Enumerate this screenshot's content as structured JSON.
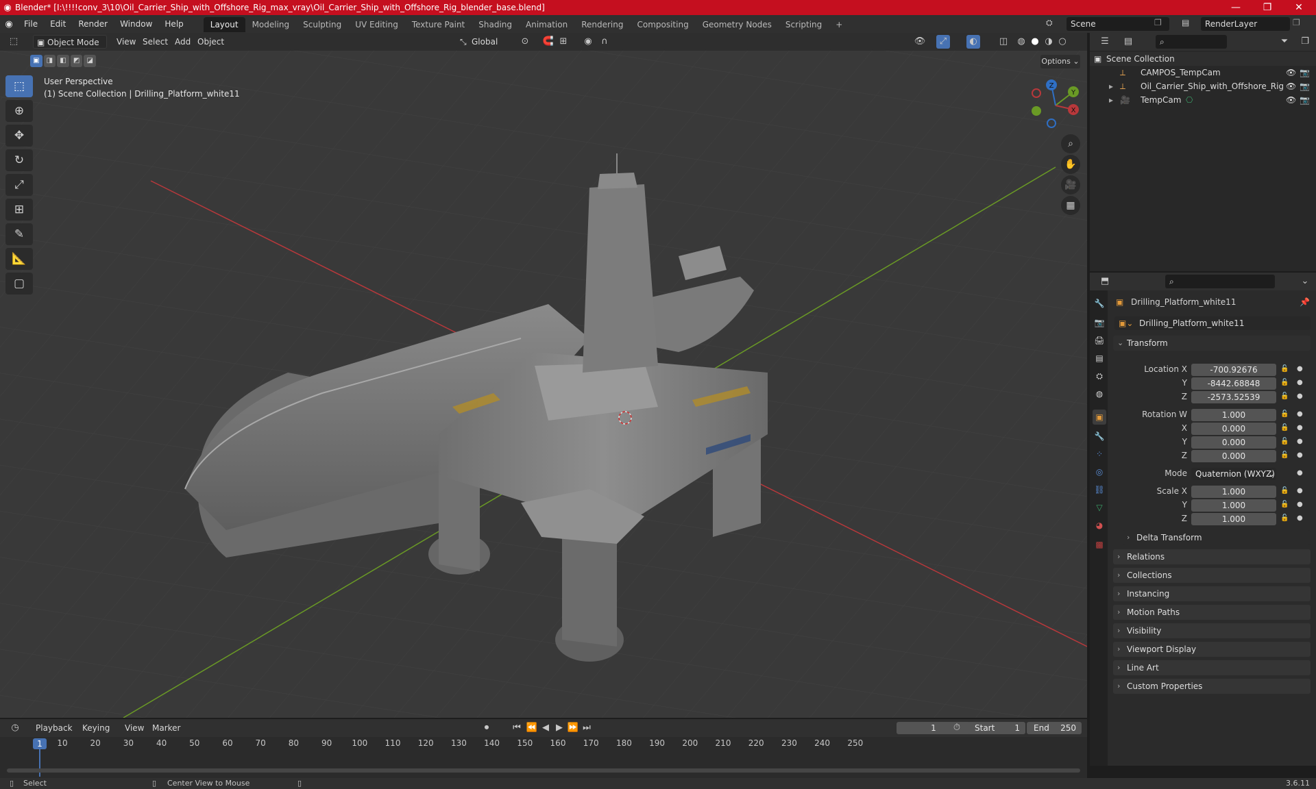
{
  "window": {
    "title": "Blender* [I:\\!!!!conv_3\\10\\Oil_Carrier_Ship_with_Offshore_Rig_max_vray\\Oil_Carrier_Ship_with_Offshore_Rig_blender_base.blend]",
    "minimize": "—",
    "maximize": "❐",
    "close": "✕"
  },
  "menus": [
    "File",
    "Edit",
    "Render",
    "Window",
    "Help"
  ],
  "workspaces": [
    "Layout",
    "Modeling",
    "Sculpting",
    "UV Editing",
    "Texture Paint",
    "Shading",
    "Animation",
    "Rendering",
    "Compositing",
    "Geometry Nodes",
    "Scripting"
  ],
  "workspace_add": "+",
  "scene": {
    "name": "Scene",
    "view_layer": "RenderLayer"
  },
  "viewport_header": {
    "mode": "Object Mode",
    "menus": [
      "View",
      "Select",
      "Add",
      "Object"
    ],
    "orientation": "Global",
    "options": "Options"
  },
  "viewport": {
    "perspective": "User Perspective",
    "collection_info": "(1) Scene Collection | Drilling_Platform_white11",
    "gizmo": {
      "x": "X",
      "y": "Y",
      "z": "Z"
    }
  },
  "outliner": {
    "root": "Scene Collection",
    "items": [
      {
        "name": "CAMPOS_TempCam"
      },
      {
        "name": "Oil_Carrier_Ship_with_Offshore_Rig"
      },
      {
        "name": "TempCam"
      }
    ]
  },
  "properties": {
    "object_name": "Drilling_Platform_white11",
    "data_name": "Drilling_Platform_white11",
    "transform": {
      "header": "Transform",
      "location_label": "Location X",
      "location": [
        "-700.92676",
        "-8442.68848",
        "-2573.52539"
      ],
      "rotation_label": "Rotation W",
      "rotation": [
        "1.000",
        "0.000",
        "0.000",
        "0.000"
      ],
      "mode_label": "Mode",
      "mode": "Quaternion (WXYZ)",
      "scale_label": "Scale X",
      "scale": [
        "1.000",
        "1.000",
        "1.000"
      ],
      "axis_labels": {
        "x": "X",
        "y": "Y",
        "z": "Z"
      },
      "delta": "Delta Transform"
    },
    "panels": [
      "Relations",
      "Collections",
      "Instancing",
      "Motion Paths",
      "Visibility",
      "Viewport Display",
      "Line Art",
      "Custom Properties"
    ]
  },
  "timeline": {
    "menus": [
      "Playback",
      "Keying",
      "View",
      "Marker"
    ],
    "current_frame": "1",
    "start_label": "Start",
    "start": "1",
    "end_label": "End",
    "end": "250",
    "ticks": [
      "10",
      "20",
      "30",
      "40",
      "50",
      "60",
      "70",
      "80",
      "90",
      "100",
      "110",
      "120",
      "130",
      "140",
      "150",
      "160",
      "170",
      "180",
      "190",
      "200",
      "210",
      "220",
      "230",
      "240",
      "250"
    ],
    "playhead": "1"
  },
  "status": {
    "left": "Select",
    "middle": "Center View to Mouse",
    "version": "3.6.11"
  },
  "colors": {
    "titlebar": "#c50f1f",
    "accent": "#4772b3",
    "x_axis": "#b8383b",
    "y_axis": "#6a9a25",
    "z_axis": "#2f6fc4"
  }
}
